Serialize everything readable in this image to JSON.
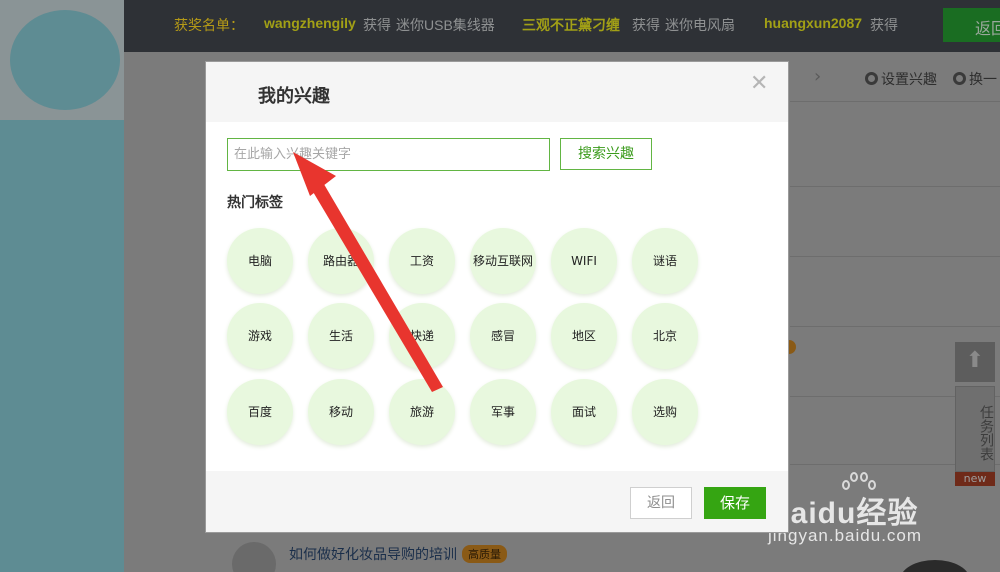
{
  "topbar": {
    "winners_label": "获奖名单：",
    "items": [
      {
        "user": "wangzhengily",
        "got": "获得",
        "prize": "迷你USB集线器"
      },
      {
        "user": "三观不正黛刁缠",
        "got": "获得",
        "prize": "迷你电风扇"
      },
      {
        "user": "huangxun2087",
        "got": "获得",
        "prize": ""
      }
    ],
    "back_label": "返回"
  },
  "background": {
    "settings_link": "设置兴趣",
    "refresh_link": "换一",
    "side_task": "任务列表",
    "side_new": "new",
    "article_title": "如何做好化妆品导购的培训",
    "article_badge": "高质量"
  },
  "watermark": {
    "brand": "Baidu经验",
    "url": "jingyan.baidu.com"
  },
  "modal": {
    "title": "我的兴趣",
    "search_placeholder": "在此输入兴趣关键字",
    "search_button": "搜索兴趣",
    "hot_label": "热门标签",
    "tags": [
      "电脑",
      "路由器",
      "工资",
      "移动互联网",
      "WIFI",
      "谜语",
      "游戏",
      "生活",
      "快递",
      "感冒",
      "地区",
      "北京",
      "百度",
      "移动",
      "旅游",
      "军事",
      "面试",
      "选购"
    ],
    "back_button": "返回",
    "save_button": "保存"
  },
  "colors": {
    "accent_green": "#35a512",
    "tag_bg": "#e8f8de",
    "annotation_red": "#e8352e"
  }
}
